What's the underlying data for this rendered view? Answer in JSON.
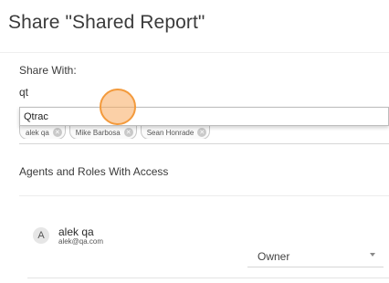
{
  "dialog": {
    "title": "Share \"Shared Report\""
  },
  "share": {
    "label": "Share With:",
    "input_value": "qt"
  },
  "autocomplete": {
    "options": [
      "Qtrac"
    ]
  },
  "selected_users": [
    {
      "name": "alek qa"
    },
    {
      "name": "Mike Barbosa"
    },
    {
      "name": "Sean Honrade"
    }
  ],
  "access": {
    "heading": "Agents and Roles With Access",
    "entries": [
      {
        "avatar_initial": "A",
        "name": "alek qa",
        "email": "alek@qa.com",
        "role": "Owner"
      }
    ]
  },
  "icons": {
    "chip_remove": "close-icon",
    "role_dropdown": "caret-down-icon"
  },
  "colors": {
    "click_indicator": "#f39a3c"
  }
}
